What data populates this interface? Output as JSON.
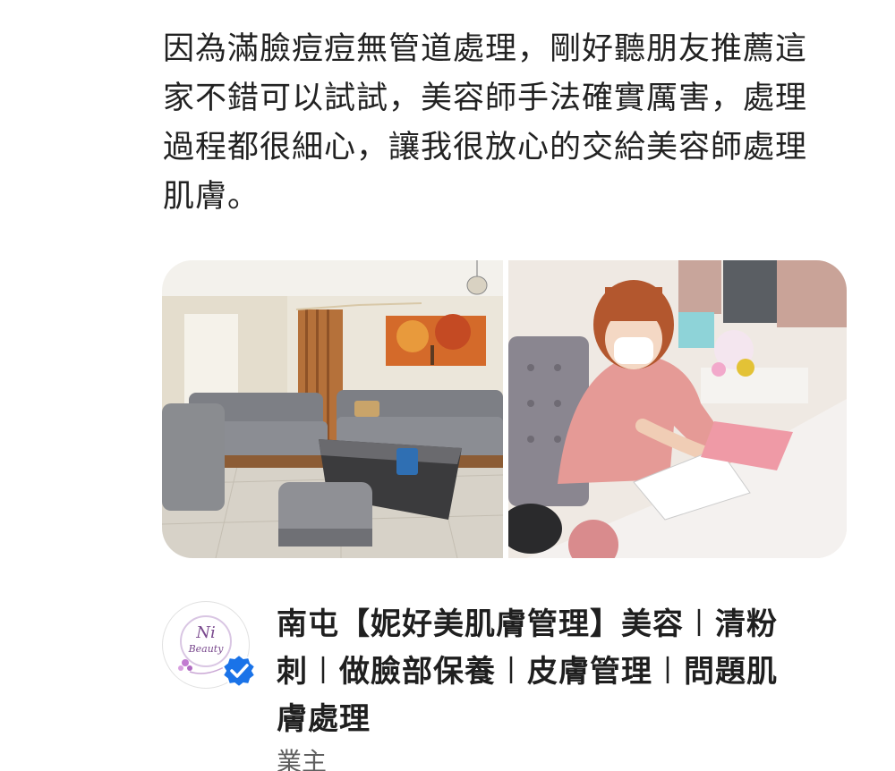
{
  "review": {
    "lines": [
      "因為滿臉痘痘無管道處理，剛好聽朋友推薦這",
      "家不錯可以試試，美容師手法確實厲害，處理",
      "過程都很細心，讓我很放心的交給美容師處理",
      "肌膚。"
    ]
  },
  "photos": {
    "left_icon": "living-room-photo",
    "right_icon": "customer-signing-photo"
  },
  "owner": {
    "name_lines": [
      "南屯【妮好美肌膚管理】美容︱清粉",
      "刺︱做臉部保養︱皮膚管理︱問題肌",
      "膚處理"
    ],
    "role": "業主",
    "verified_icon": "verified-badge-icon",
    "verified_color": "#1a73e8",
    "avatar_logo_text": "Ni",
    "avatar_logo_subtext": "Beauty"
  }
}
